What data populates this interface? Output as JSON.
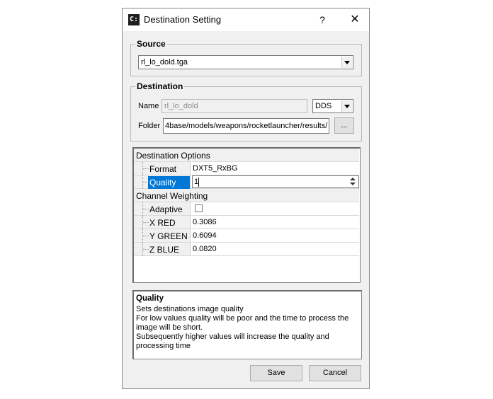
{
  "window": {
    "icon_text": "C:",
    "title": "Destination Setting",
    "help_glyph": "?",
    "close_glyph": "✕"
  },
  "source": {
    "group_title": "Source",
    "file_value": "rl_lo_dold.tga"
  },
  "destination": {
    "group_title": "Destination",
    "name_label": "Name",
    "name_value": "rl_lo_dold",
    "format_value": "DDS",
    "folder_label": "Folder",
    "folder_value": "4base/models/weapons/rocketlauncher/results/",
    "browse_label": "..."
  },
  "properties": {
    "options_category": "Destination Options",
    "format_name": "Format",
    "format_value": "DXT5_RxBG",
    "quality_name": "Quality",
    "quality_value": "1",
    "weighting_category": "Channel Weighting",
    "adaptive_name": "Adaptive",
    "xred_name": "X RED",
    "xred_value": "0.3086",
    "ygreen_name": "Y GREEN",
    "ygreen_value": "0.6094",
    "zblue_name": "Z BLUE",
    "zblue_value": "0.0820"
  },
  "description": {
    "title": "Quality",
    "line1": "Sets destinations image quality",
    "line2": "For low values quality will be poor and the time to process the",
    "line3": "image will be short.",
    "line4": "Subsequently higher values will increase the quality and",
    "line5": "processing time"
  },
  "buttons": {
    "save_label": "Save",
    "cancel_label": "Cancel"
  },
  "colors": {
    "selection": "#0078d7",
    "dialog_bg": "#f0f0f0"
  }
}
